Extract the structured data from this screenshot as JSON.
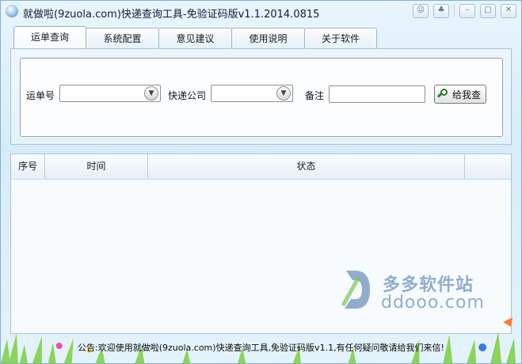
{
  "window": {
    "title": "就做啦(9zuola.com)快递查询工具-免验证码版v1.1.2014.0815",
    "controls": [
      "chat-icon",
      "skin-icon",
      "minimize-icon",
      "maximize-icon",
      "close-icon"
    ]
  },
  "tabs": [
    {
      "label": "运单查询",
      "active": true
    },
    {
      "label": "系统配置",
      "active": false
    },
    {
      "label": "意见建议",
      "active": false
    },
    {
      "label": "使用说明",
      "active": false
    },
    {
      "label": "关于软件",
      "active": false
    }
  ],
  "form": {
    "tracking_label": "运单号",
    "tracking_value": "",
    "company_label": "快递公司",
    "company_value": "",
    "note_label": "备注",
    "note_value": "",
    "query_button": "给我查"
  },
  "table": {
    "columns": [
      "序号",
      "时间",
      "状态",
      ""
    ],
    "rows": []
  },
  "watermark": {
    "cn": "多多软件站",
    "en": "ddooo.com"
  },
  "notice": "公告:欢迎使用就做啦(9zuola.com)快递查询工具,免验证码版v1.1,有任何疑问敬请给我们来信!",
  "colors": {
    "accent": "#7fb2d6",
    "button_icon": "#2f7a2a",
    "window_bg": "#d7ecf8"
  }
}
